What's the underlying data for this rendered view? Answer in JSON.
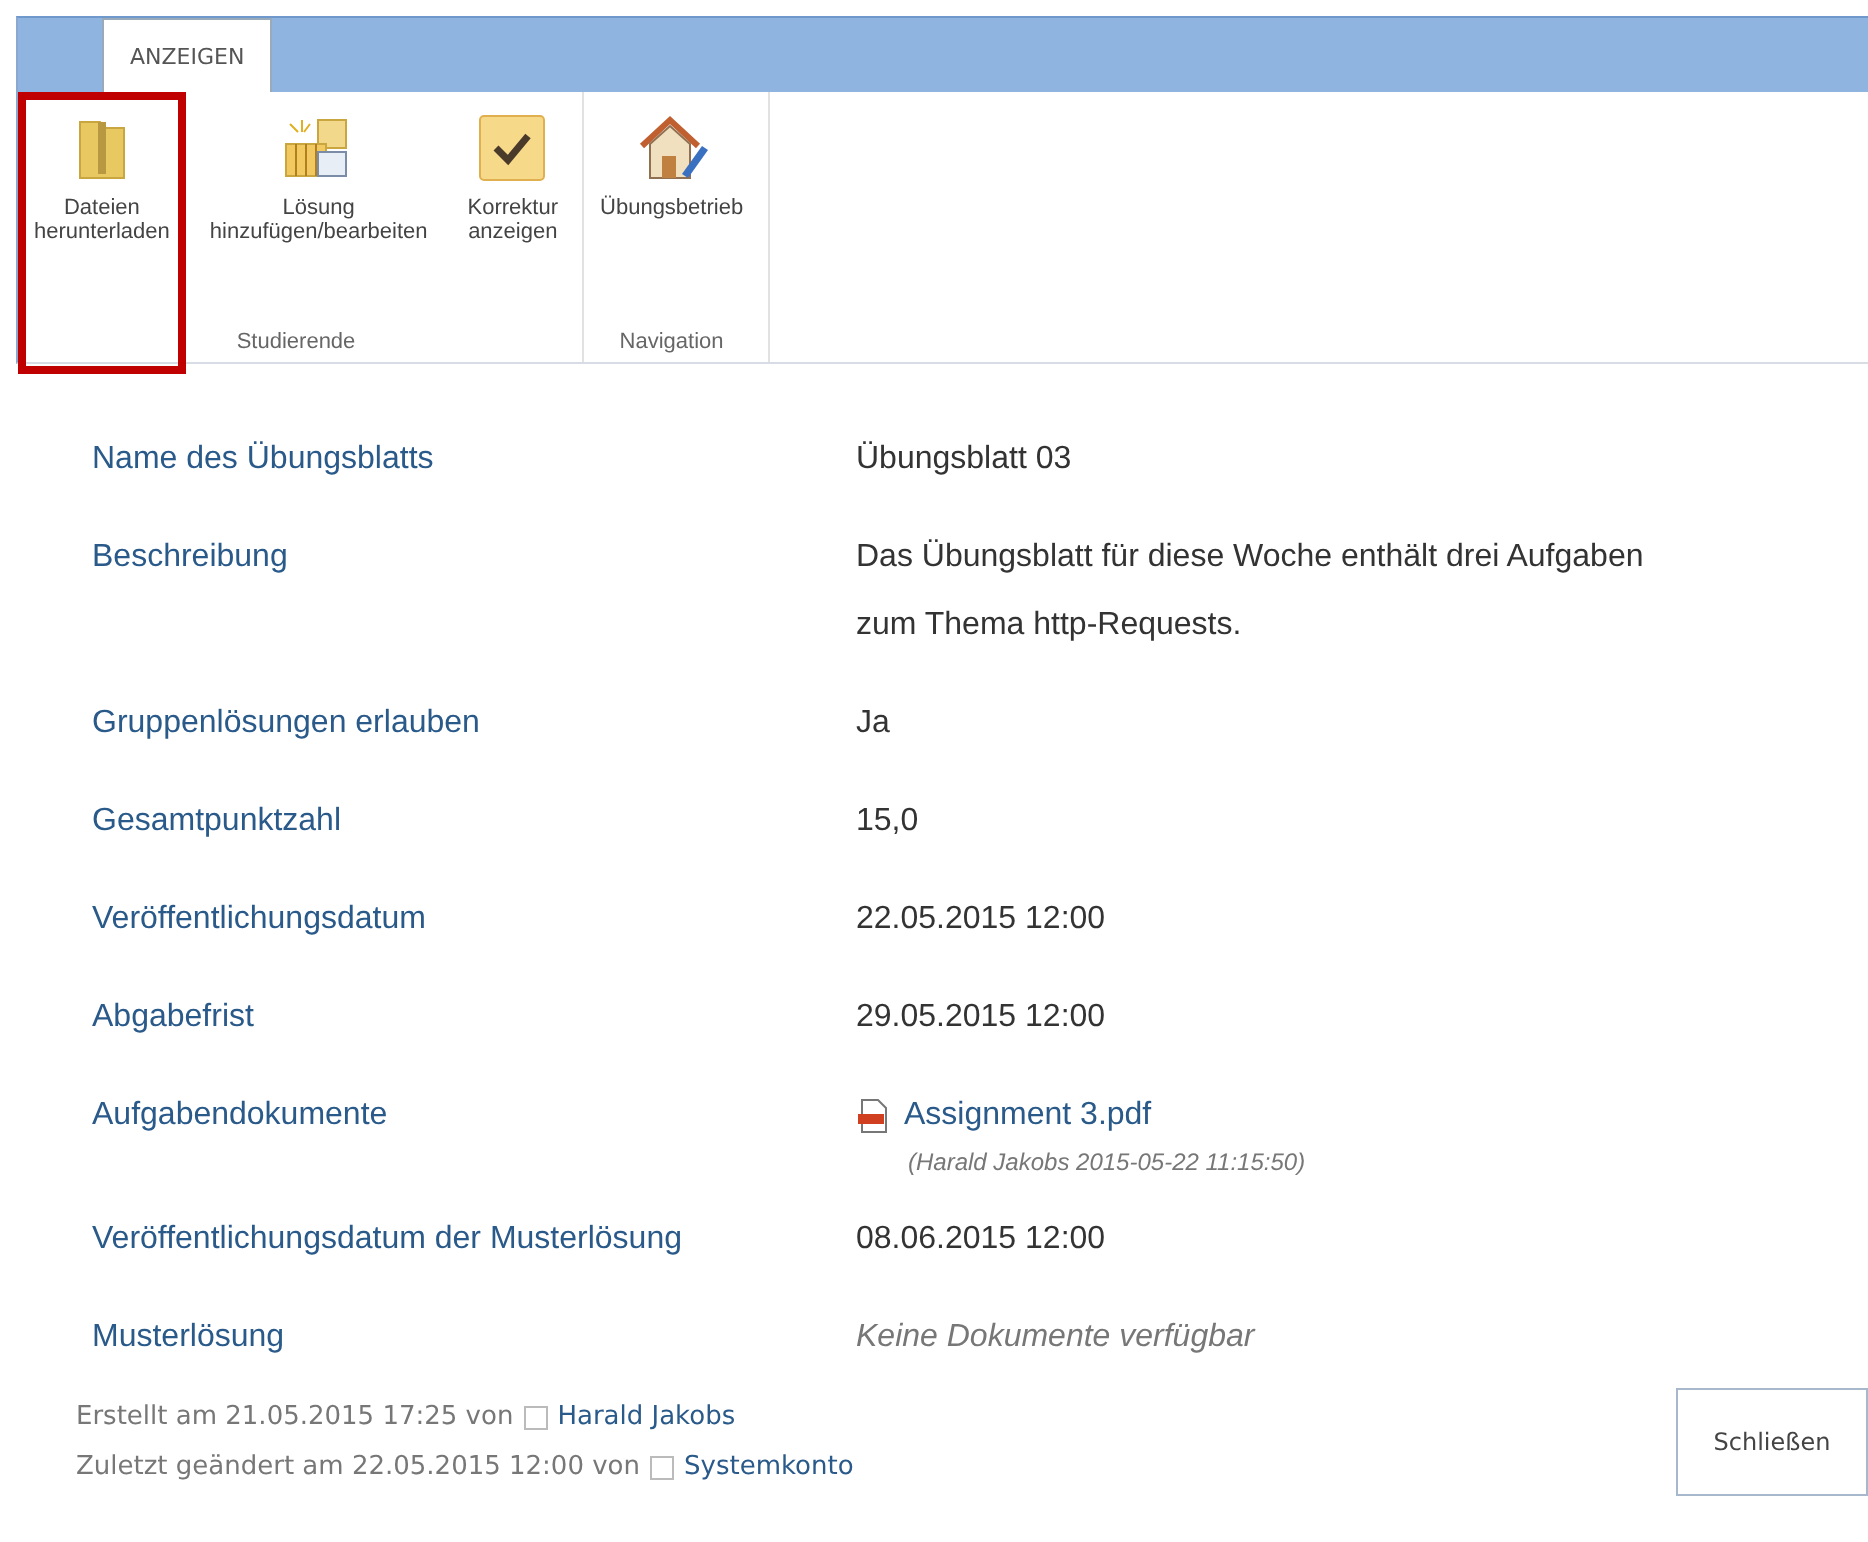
{
  "ribbon": {
    "tabs": [
      {
        "label": "ANZEIGEN",
        "selected": true
      }
    ],
    "groups": [
      {
        "label": "Studierende",
        "buttons": [
          {
            "label": "Dateien herunterladen",
            "highlighted": true
          },
          {
            "label": "Lösung hinzufügen/bearbeiten",
            "highlighted": false
          },
          {
            "label": "Korrektur anzeigen",
            "highlighted": false
          }
        ]
      },
      {
        "label": "Navigation",
        "buttons": [
          {
            "label": "Übungsbetrieb",
            "highlighted": false
          }
        ]
      }
    ]
  },
  "fields": [
    {
      "label": "Name des Übungsblatts",
      "kind": "text",
      "value": "Übungsblatt 03"
    },
    {
      "label": "Beschreibung",
      "kind": "text",
      "value": "Das Übungsblatt für diese Woche enthält drei Aufgaben zum Thema http-Requests."
    },
    {
      "label": "Gruppenlösungen erlauben",
      "kind": "text",
      "value": "Ja"
    },
    {
      "label": "Gesamtpunktzahl",
      "kind": "text",
      "value": "15,0"
    },
    {
      "label": "Veröffentlichungsdatum",
      "kind": "text",
      "value": "22.05.2015 12:00"
    },
    {
      "label": "Abgabefrist",
      "kind": "text",
      "value": "29.05.2015 12:00"
    },
    {
      "label": "Aufgabendokumente",
      "kind": "document",
      "value": "Assignment 3.pdf",
      "note": "(Harald Jakobs 2015-05-22 11:15:50)"
    },
    {
      "label": "Veröffentlichungsdatum der Musterlösung",
      "kind": "text",
      "value": "08.06.2015 12:00"
    },
    {
      "label": "Musterlösung",
      "kind": "empty",
      "value": "Keine Dokumente verfügbar"
    }
  ],
  "footer": [
    {
      "text": "Erstellt am 21.05.2015 17:25  von",
      "user": "Harald Jakobs"
    },
    {
      "text": "Zuletzt geändert am 22.05.2015 12:00  von",
      "user": "Systemkonto"
    }
  ],
  "close_button": "Schließen"
}
